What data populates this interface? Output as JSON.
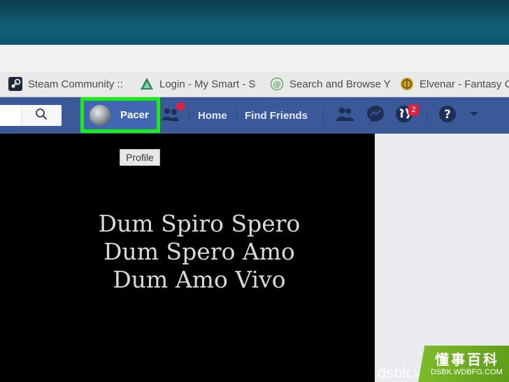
{
  "bookmarks": [
    {
      "label": "Steam Community ::",
      "icon": "steam-icon"
    },
    {
      "label": "Login - My Smart - S",
      "icon": "triangle-logo-icon"
    },
    {
      "label": "Search and Browse Y",
      "icon": "at-sign-icon"
    },
    {
      "label": "Elvenar - Fantasy C",
      "icon": "tree-emblem-icon"
    }
  ],
  "fb_nav": {
    "profile_name": "Pacer",
    "home": "Home",
    "find_friends": "Find Friends",
    "notification_count": "2"
  },
  "tooltip": "Profile",
  "quote": {
    "line1": "Dum Spiro Spero",
    "line2": "Dum Spero Amo",
    "line3": "Dum Amo Vivo"
  },
  "watermark": {
    "site": "dsbk.wdbfg.com",
    "chinese": "懂事百科",
    "url": "DSBK.WDBFG.COM"
  },
  "colors": {
    "facebook_blue": "#3b5998",
    "highlight_green": "#1aee16",
    "badge_red": "#e41e3f"
  }
}
